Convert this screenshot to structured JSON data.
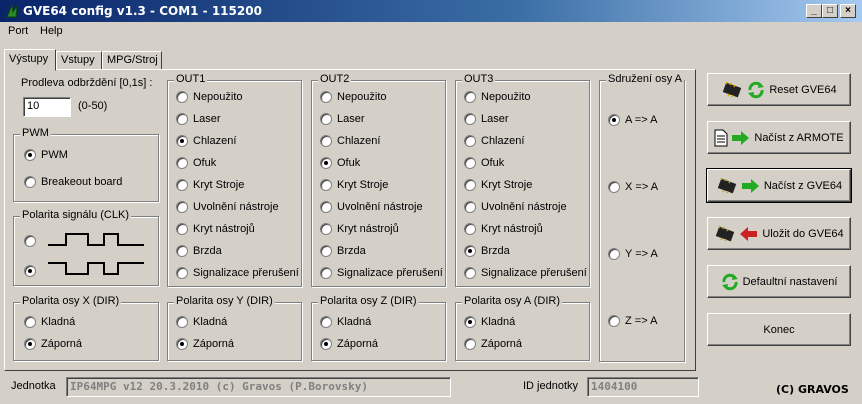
{
  "window": {
    "title": "GVE64 config v1.3 - COM1 - 115200",
    "buttons": [
      "_",
      "□",
      "×"
    ]
  },
  "menu": [
    "Port",
    "Help"
  ],
  "tabs": [
    {
      "label": "Výstupy",
      "active": true
    },
    {
      "label": "Vstupy",
      "active": false
    },
    {
      "label": "MPG/Stroj",
      "active": false
    }
  ],
  "prodleva": {
    "label": "Prodleva odbrždění [0,1s] :",
    "value": "10",
    "range": "(0-50)"
  },
  "pwm": {
    "title": "PWM",
    "options": [
      "PWM",
      "Breakeout board"
    ],
    "selected": 0
  },
  "clk": {
    "title": "Polarita signálu (CLK)",
    "selected": 1
  },
  "out1": {
    "title": "OUT1",
    "selected": 2
  },
  "out2": {
    "title": "OUT2",
    "selected": 3
  },
  "out3": {
    "title": "OUT3",
    "selected": 7
  },
  "out_options": [
    "Nepoužito",
    "Laser",
    "Chlazení",
    "Ofuk",
    "Kryt Stroje",
    "Uvolnění nástroje",
    "Kryt nástrojů",
    "Brzda",
    "Signalizace přerušení"
  ],
  "axis_a_pair": {
    "title": "Sdružení osy A",
    "options": [
      "A => A",
      "X => A",
      "Y => A",
      "Z => A"
    ],
    "selected": 0
  },
  "dir": {
    "options": [
      "Kladná",
      "Záporná"
    ],
    "x": {
      "title": "Polarita osy X (DIR)",
      "selected": 1
    },
    "y": {
      "title": "Polarita osy Y (DIR)",
      "selected": 1
    },
    "z": {
      "title": "Polarita osy Z (DIR)",
      "selected": 1
    },
    "a": {
      "title": "Polarita osy A (DIR)",
      "selected": 0
    }
  },
  "buttons": {
    "reset": "Reset GVE64",
    "load_armote": "Načíst z ARMOTE",
    "load_gve": "Načíst z GVE64",
    "save_gve": "Uložit do GVE64",
    "defaults": "Defaultní nastavení",
    "exit": "Konec"
  },
  "footer": {
    "unit_label": "Jednotka",
    "unit_value": "IP64MPG v12 20.3.2010 (c) Gravos (P.Borovsky)",
    "id_label": "ID jednotky",
    "id_value": "1404100",
    "copyright": "(C) GRAVOS"
  },
  "colors": {
    "title_start": "#0a246a",
    "title_end": "#a6caf0",
    "face": "#d4d0c8",
    "arrow_green": "#22aa22",
    "arrow_red": "#cc2222"
  }
}
